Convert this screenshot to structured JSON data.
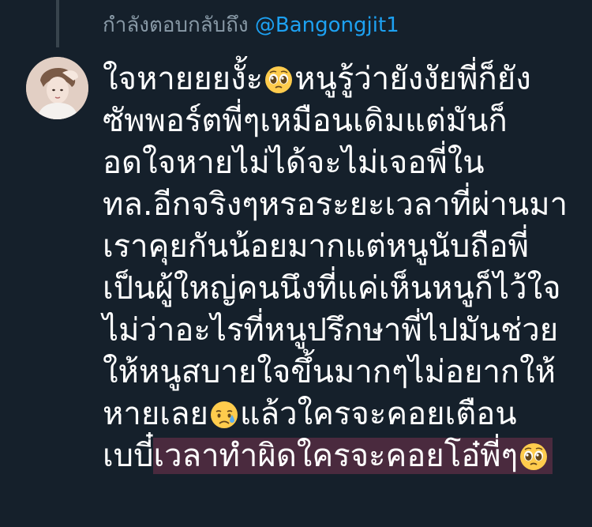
{
  "reply_context": {
    "prefix": "กำลังตอบกลับถึง",
    "handle": "@Bangongjit1"
  },
  "user": {
    "avatar_icon": "profile-avatar"
  },
  "tweet": {
    "line1_a": "ใจหายยยงั้ะ",
    "line1_b": "หนูรู้ว่ายังงัยพี่ก็ยัง",
    "line2": "ซัพพอร์ตพี่ๆเหมือนเดิมแต่มันก็",
    "line3": "อดใจหายไม่ได้จะไม่เจอพี่ใน",
    "line4": "ทล.อีกจริงๆหรอระยะเวลาที่ผ่านมา",
    "line5": "เราคุยกันน้อยมากแต่หนูนับถือพี่",
    "line6": "เป็นผู้ใหญ่คนนึงที่แค่เห็นหนูก็ไว้ใจ",
    "line7": "ไม่ว่าอะไรที่หนูปรึกษาพี่ไปมันช่วย",
    "line8": "ให้หนูสบายใจขึ้นมากๆไม่อยากให้",
    "line9_a": "หายเลย",
    "line9_b": "แล้วใครจะคอยเตือน",
    "line10_a": "เบบี๋",
    "line10_b": "เวลาทำผิดใครจะคอยโอ๋พี่ๆ"
  },
  "emoji": {
    "pleading": "pleading-face-emoji",
    "sad_sweat": "sad-relieved-face-emoji"
  },
  "colors": {
    "background": "#15202b",
    "text": "#ffffff",
    "muted": "#8899a6",
    "link": "#1da1f2",
    "highlight": "#4a2a3e",
    "thread_line": "#38444d"
  }
}
